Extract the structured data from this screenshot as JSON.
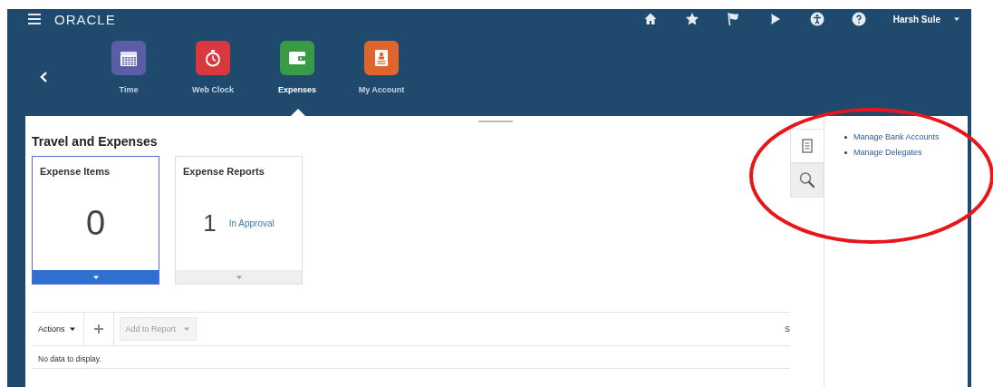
{
  "header": {
    "logo": "ORACLE",
    "user": "Harsh Sule",
    "apps": [
      {
        "label": "Time",
        "kind": "calendar",
        "color": "#5b5ea6",
        "selected": false
      },
      {
        "label": "Web Clock",
        "kind": "stopwatch",
        "color": "#d9383e",
        "selected": false
      },
      {
        "label": "Expenses",
        "kind": "wallet",
        "color": "#3a9b47",
        "selected": true
      },
      {
        "label": "My Account",
        "kind": "badge",
        "color": "#e0652c",
        "selected": false
      }
    ]
  },
  "page_title": "Travel and Expenses",
  "tiles": [
    {
      "title": "Expense Items",
      "count": "0",
      "selected": true
    },
    {
      "title": "Expense Reports",
      "count": "1",
      "status": "In Approval",
      "selected": false
    }
  ],
  "toolbar": {
    "actions": "Actions",
    "add_to_report": "Add to Report",
    "cut_text": "S"
  },
  "table": {
    "empty_message": "No data to display."
  },
  "side_panel": {
    "tabs": [
      {
        "kind": "tasks",
        "selected": true
      },
      {
        "kind": "search",
        "selected": false
      }
    ],
    "links": [
      "Manage Bank Accounts",
      "Manage Delegates"
    ]
  }
}
